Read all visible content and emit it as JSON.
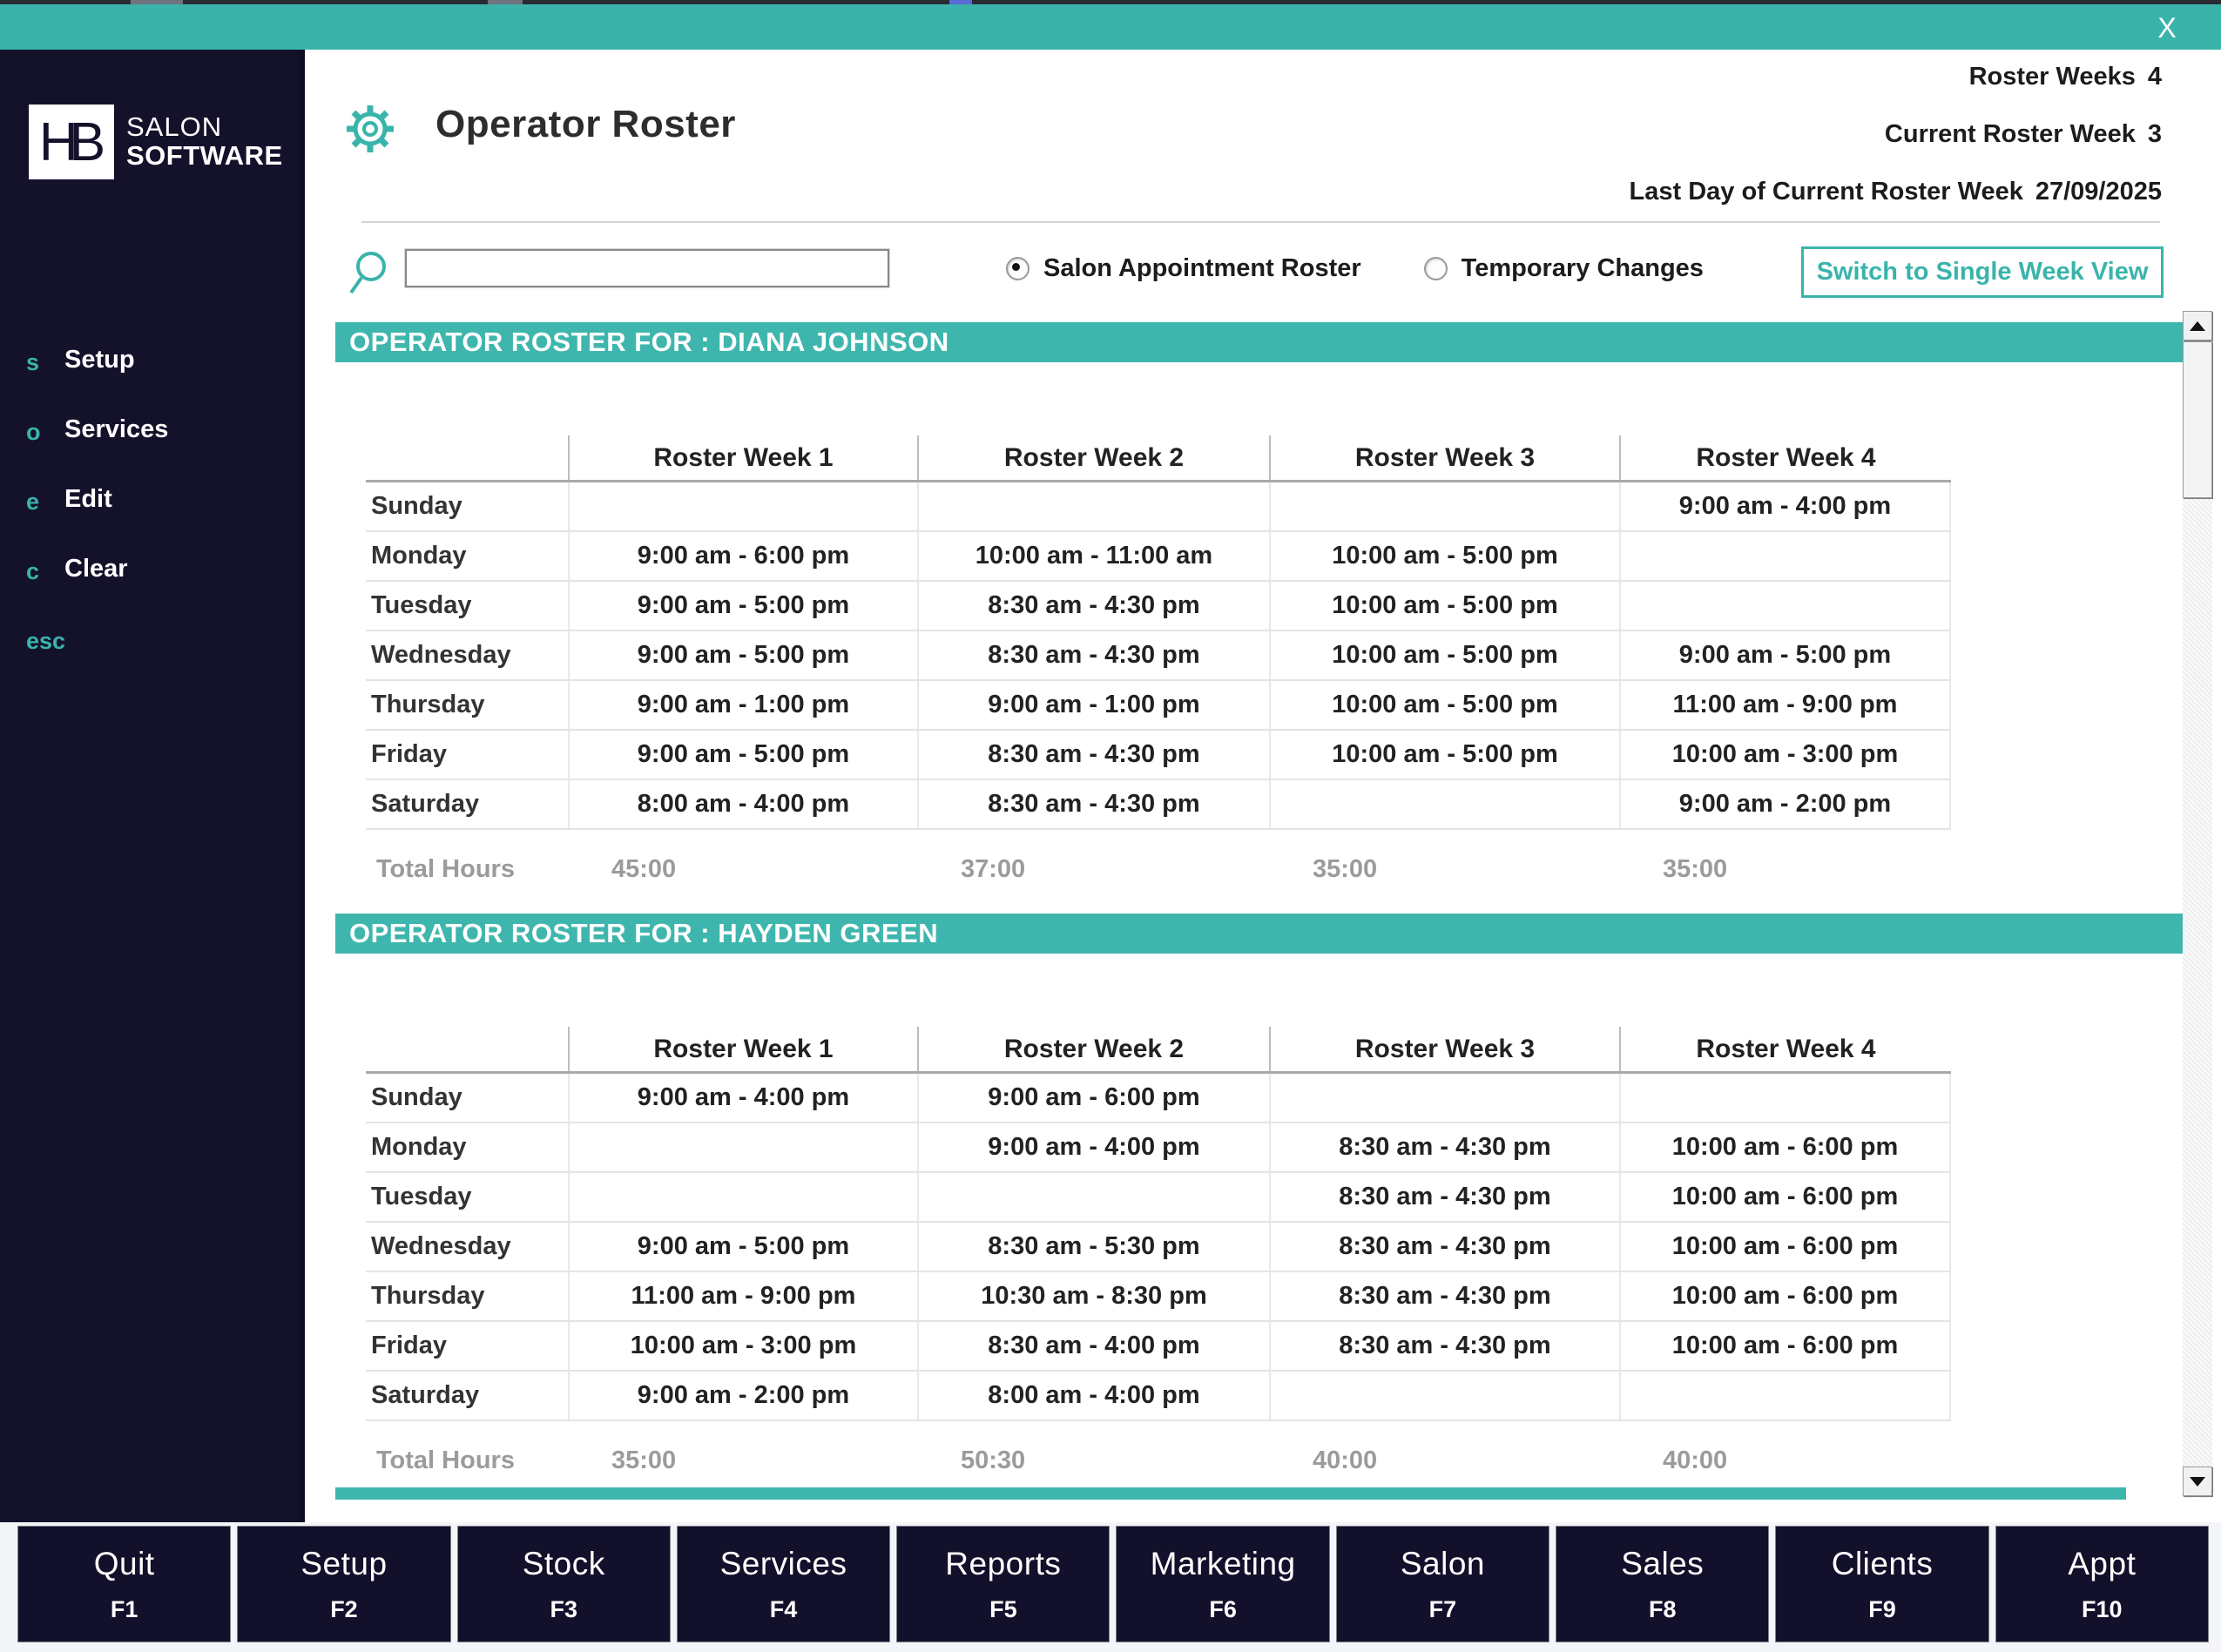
{
  "titlebar": {
    "close_label": "X"
  },
  "sidebar": {
    "logo": {
      "monogram": "HB",
      "line1": "SALON",
      "line2": "SOFTWARE"
    },
    "items": [
      {
        "key": "s",
        "label": "Setup"
      },
      {
        "key": "o",
        "label": "Services"
      },
      {
        "key": "e",
        "label": "Edit"
      },
      {
        "key": "c",
        "label": "Clear"
      },
      {
        "key": "esc",
        "label": ""
      }
    ]
  },
  "header": {
    "title": "Operator Roster",
    "info": [
      {
        "label": "Roster Weeks",
        "value": "4"
      },
      {
        "label": "Current Roster Week",
        "value": "3"
      },
      {
        "label": "Last Day of Current Roster Week",
        "value": "27/09/2025"
      }
    ]
  },
  "controls": {
    "search_value": "",
    "radios": [
      {
        "label": "Salon Appointment Roster",
        "selected": true
      },
      {
        "label": "Temporary Changes",
        "selected": false
      }
    ],
    "switch_button_label": "Switch to Single Week View"
  },
  "rosters": [
    {
      "section_title": "OPERATOR ROSTER FOR : DIANA JOHNSON",
      "columns": [
        "Roster Week 1",
        "Roster Week 2",
        "Roster Week 3",
        "Roster Week 4"
      ],
      "rows": [
        {
          "day": "Sunday",
          "times": [
            "",
            "",
            "",
            "9:00 am - 4:00 pm"
          ]
        },
        {
          "day": "Monday",
          "times": [
            "9:00 am - 6:00 pm",
            "10:00 am - 11:00 am",
            "10:00 am - 5:00 pm",
            ""
          ]
        },
        {
          "day": "Tuesday",
          "times": [
            "9:00 am - 5:00 pm",
            "8:30 am - 4:30 pm",
            "10:00 am - 5:00 pm",
            ""
          ]
        },
        {
          "day": "Wednesday",
          "times": [
            "9:00 am - 5:00 pm",
            "8:30 am - 4:30 pm",
            "10:00 am - 5:00 pm",
            "9:00 am - 5:00 pm"
          ]
        },
        {
          "day": "Thursday",
          "times": [
            "9:00 am - 1:00 pm",
            "9:00 am - 1:00 pm",
            "10:00 am - 5:00 pm",
            "11:00 am - 9:00 pm"
          ]
        },
        {
          "day": "Friday",
          "times": [
            "9:00 am - 5:00 pm",
            "8:30 am - 4:30 pm",
            "10:00 am - 5:00 pm",
            "10:00 am - 3:00 pm"
          ]
        },
        {
          "day": "Saturday",
          "times": [
            "8:00 am - 4:00 pm",
            "8:30 am - 4:30 pm",
            "",
            "9:00 am - 2:00 pm"
          ]
        }
      ],
      "total_label": "Total Hours",
      "totals": [
        "45:00",
        "37:00",
        "35:00",
        "35:00"
      ]
    },
    {
      "section_title": "OPERATOR ROSTER FOR : HAYDEN GREEN",
      "columns": [
        "Roster Week 1",
        "Roster Week 2",
        "Roster Week 3",
        "Roster Week 4"
      ],
      "rows": [
        {
          "day": "Sunday",
          "times": [
            "9:00 am - 4:00 pm",
            "9:00 am - 6:00 pm",
            "",
            ""
          ]
        },
        {
          "day": "Monday",
          "times": [
            "",
            "9:00 am - 4:00 pm",
            "8:30 am - 4:30 pm",
            "10:00 am - 6:00 pm"
          ]
        },
        {
          "day": "Tuesday",
          "times": [
            "",
            "",
            "8:30 am - 4:30 pm",
            "10:00 am - 6:00 pm"
          ]
        },
        {
          "day": "Wednesday",
          "times": [
            "9:00 am - 5:00 pm",
            "8:30 am - 5:30 pm",
            "8:30 am - 4:30 pm",
            "10:00 am - 6:00 pm"
          ]
        },
        {
          "day": "Thursday",
          "times": [
            "11:00 am - 9:00 pm",
            "10:30 am - 8:30 pm",
            "8:30 am - 4:30 pm",
            "10:00 am - 6:00 pm"
          ]
        },
        {
          "day": "Friday",
          "times": [
            "10:00 am - 3:00 pm",
            "8:30 am - 4:00 pm",
            "8:30 am - 4:30 pm",
            "10:00 am - 6:00 pm"
          ]
        },
        {
          "day": "Saturday",
          "times": [
            "9:00 am - 2:00 pm",
            "8:00 am - 4:00 pm",
            "",
            ""
          ]
        }
      ],
      "total_label": "Total Hours",
      "totals": [
        "35:00",
        "50:30",
        "40:00",
        "40:00"
      ]
    }
  ],
  "fkeys": [
    {
      "label": "Quit",
      "key": "F1"
    },
    {
      "label": "Setup",
      "key": "F2"
    },
    {
      "label": "Stock",
      "key": "F3"
    },
    {
      "label": "Services",
      "key": "F4"
    },
    {
      "label": "Reports",
      "key": "F5"
    },
    {
      "label": "Marketing",
      "key": "F6"
    },
    {
      "label": "Salon",
      "key": "F7"
    },
    {
      "label": "Sales",
      "key": "F8"
    },
    {
      "label": "Clients",
      "key": "F9"
    },
    {
      "label": "Appt",
      "key": "F10"
    }
  ],
  "colors": {
    "teal": "#3ab4ab",
    "navy": "#14122b",
    "header_teal": "#3fb6ad",
    "total_gray": "#9b9b9b"
  }
}
